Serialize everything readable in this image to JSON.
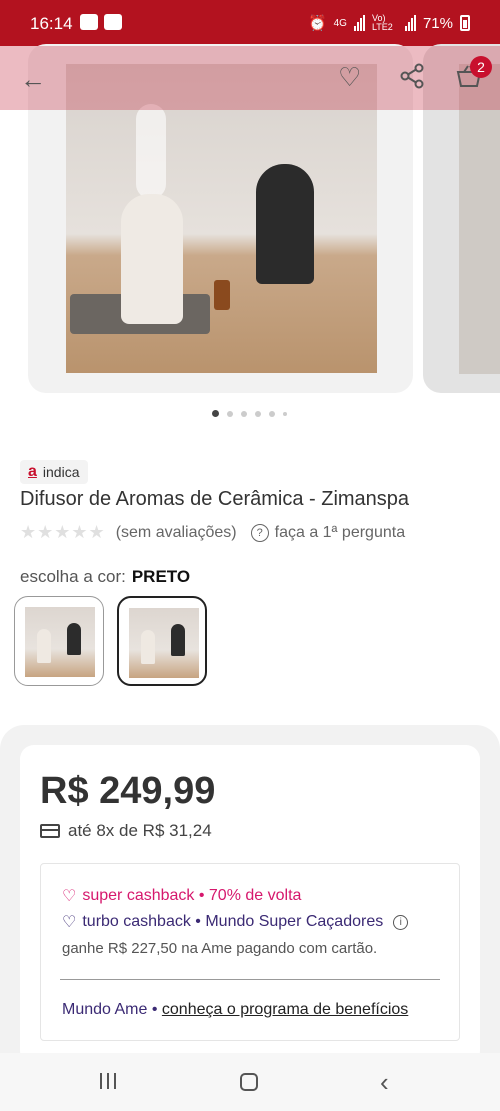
{
  "status_bar": {
    "time": "16:14",
    "network": "4G",
    "carrier_label": "Vo) LTE2",
    "battery": "71%"
  },
  "top_bar": {
    "cart_count": "2"
  },
  "gallery": {
    "total_images": 6,
    "active_index": 1
  },
  "product": {
    "badge_label": "indica",
    "badge_logo": "a",
    "title": "Difusor de Aromas de Cerâmica - Zimanspa",
    "reviews_text": "(sem avaliações)",
    "question_text": "faça a 1ª pergunta",
    "color_label": "escolha a cor:",
    "color_value": "PRETO"
  },
  "pricing": {
    "price": "R$ 249,99",
    "installments": "até 8x de R$ 31,24",
    "super_cashback": "super cashback • 70% de volta",
    "turbo_cashback": "turbo cashback • Mundo Super Caçadores",
    "ame_earn": "ganhe R$ 227,50 na Ame pagando com cartão.",
    "mundo_ame": "Mundo Ame",
    "separator": "•",
    "benefits_link": "conheça o programa de benefícios"
  },
  "colors": {
    "brand_red": "#b3121f",
    "cashback_pink": "#d6186d",
    "turbo_purple": "#3b2a74"
  }
}
